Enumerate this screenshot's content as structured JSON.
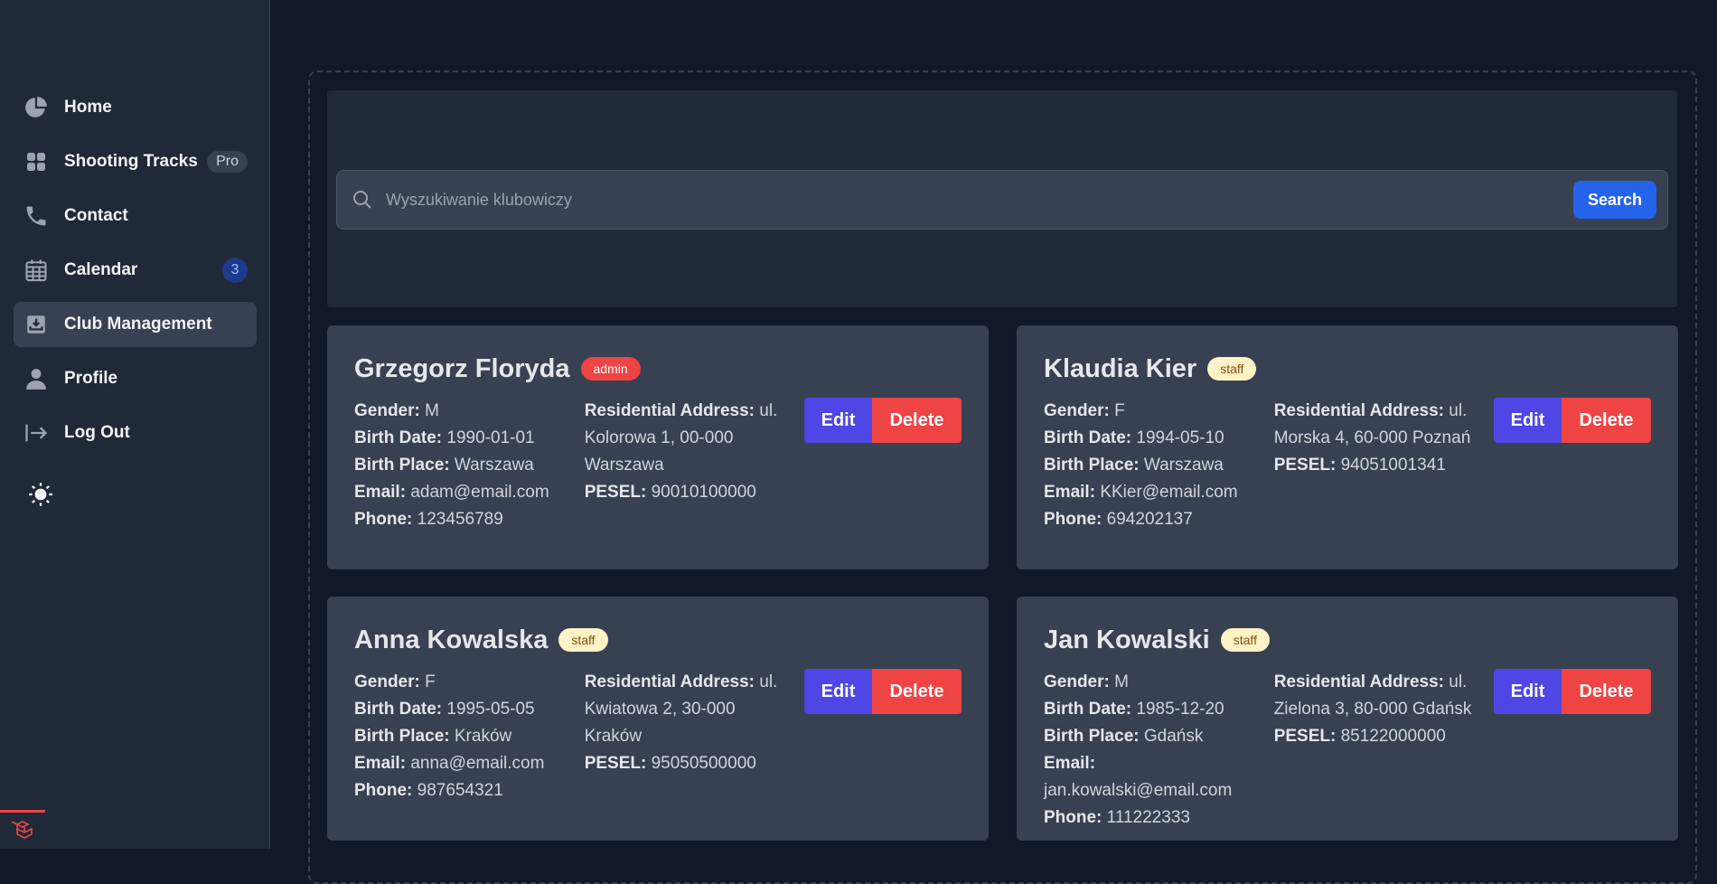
{
  "sidebar": {
    "items": [
      {
        "label": "Home",
        "icon": "pie-chart-icon"
      },
      {
        "label": "Shooting Tracks",
        "icon": "grid-icon",
        "badge": "Pro"
      },
      {
        "label": "Contact",
        "icon": "phone-icon"
      },
      {
        "label": "Calendar",
        "icon": "calendar-icon",
        "count": "3"
      },
      {
        "label": "Club Management",
        "icon": "inbox-download-icon",
        "active": true
      },
      {
        "label": "Profile",
        "icon": "user-icon"
      },
      {
        "label": "Log Out",
        "icon": "logout-icon"
      }
    ]
  },
  "search": {
    "placeholder": "Wyszukiwanie klubowiczy",
    "button": "Search"
  },
  "labels": {
    "gender": "Gender:",
    "birth_date": "Birth Date:",
    "birth_place": "Birth Place:",
    "email": "Email:",
    "phone": "Phone:",
    "address": "Residential Address:",
    "pesel": "PESEL:",
    "edit": "Edit",
    "delete": "Delete"
  },
  "members": [
    {
      "name": "Grzegorz Floryda",
      "role": "admin",
      "gender": "M",
      "birth_date": "1990-01-01",
      "birth_place": "Warszawa",
      "email": "adam@email.com",
      "phone": "123456789",
      "address": "ul. Kolorowa 1, 00-000 Warszawa",
      "pesel": "90010100000"
    },
    {
      "name": "Klaudia Kier",
      "role": "staff",
      "gender": "F",
      "birth_date": "1994-05-10",
      "birth_place": "Warszawa",
      "email": "KKier@email.com",
      "phone": "694202137",
      "address": "ul. Morska 4, 60-000 Poznań",
      "pesel": "94051001341"
    },
    {
      "name": "Anna Kowalska",
      "role": "staff",
      "gender": "F",
      "birth_date": "1995-05-05",
      "birth_place": "Kraków",
      "email": "anna@email.com",
      "phone": "987654321",
      "address": "ul. Kwiatowa 2, 30-000 Kraków",
      "pesel": "95050500000"
    },
    {
      "name": "Jan Kowalski",
      "role": "staff",
      "gender": "M",
      "birth_date": "1985-12-20",
      "birth_place": "Gdańsk",
      "email": "jan.kowalski@email.com",
      "phone": "111222333",
      "address": "ul. Zielona 3, 80-000 Gdańsk",
      "pesel": "85122000000"
    }
  ],
  "colors": {
    "background": "#111827",
    "sidebar": "#1f2937",
    "card": "#374151",
    "primary": "#2563eb",
    "edit": "#4f46e5",
    "danger": "#ef4444"
  }
}
